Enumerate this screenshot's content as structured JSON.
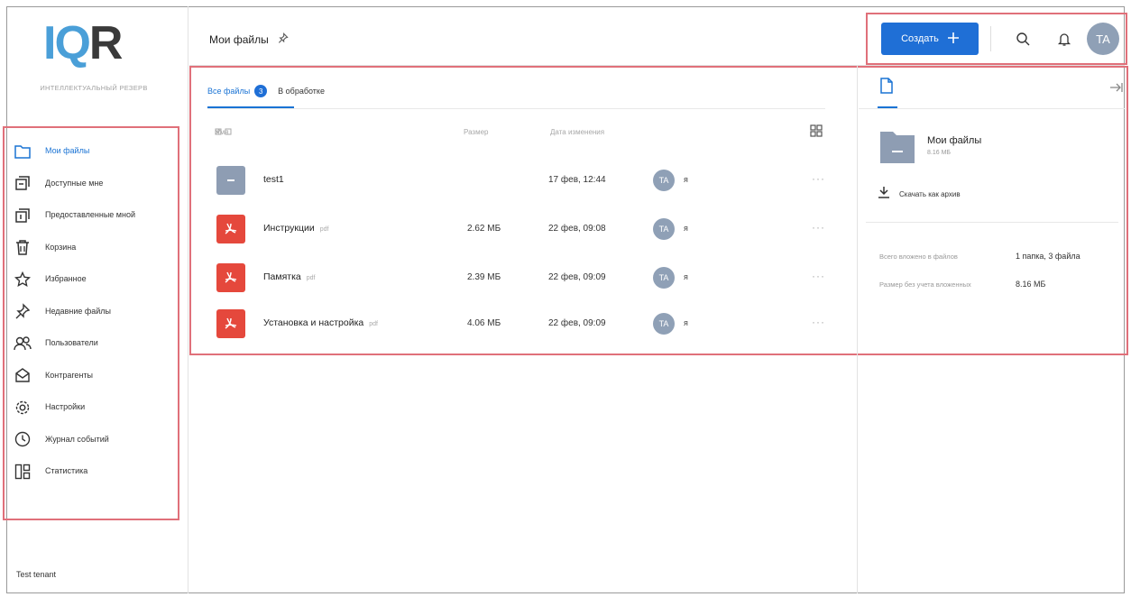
{
  "brand": {
    "logo_part1": "IQ",
    "logo_part2": "R",
    "subtitle": "ИНТЕЛЛЕКТУАЛЬНЫЙ РЕЗЕРВ"
  },
  "sidebar": {
    "items": [
      {
        "label": "Мои файлы",
        "icon": "folder-icon"
      },
      {
        "label": "Доступные мне",
        "icon": "shared-inbox-icon"
      },
      {
        "label": "Предоставленные мной",
        "icon": "shared-outbox-icon"
      },
      {
        "label": "Корзина",
        "icon": "trash-icon"
      },
      {
        "label": "Избранное",
        "icon": "star-icon"
      },
      {
        "label": "Недавние файлы",
        "icon": "pin-icon"
      },
      {
        "label": "Пользователи",
        "icon": "users-icon"
      },
      {
        "label": "Контрагенты",
        "icon": "contractors-icon"
      },
      {
        "label": "Настройки",
        "icon": "gear-icon"
      },
      {
        "label": "Журнал событий",
        "icon": "clock-icon"
      },
      {
        "label": "Статистика",
        "icon": "stats-icon"
      }
    ],
    "tenant": "Test tenant"
  },
  "header": {
    "title": "Мои файлы",
    "create_label": "Создать",
    "avatar_initials": "TA"
  },
  "tabs": [
    {
      "label": "Все файлы",
      "count": "3"
    },
    {
      "label": "В обработке"
    }
  ],
  "table": {
    "columns": {
      "name": "Имя",
      "size": "Размер",
      "date": "Дата изменения"
    },
    "rows": [
      {
        "name": "test1",
        "ext": "",
        "size": "",
        "date": "17 фев, 12:44",
        "avatar": "TA",
        "owner": "я",
        "type": "folder"
      },
      {
        "name": "Инструкции",
        "ext": "pdf",
        "size": "2.62 МБ",
        "date": "22 фев, 09:08",
        "avatar": "TA",
        "owner": "я",
        "type": "pdf"
      },
      {
        "name": "Памятка",
        "ext": "pdf",
        "size": "2.39 МБ",
        "date": "22 фев, 09:09",
        "avatar": "TA",
        "owner": "я",
        "type": "pdf"
      },
      {
        "name": "Установка и настройка",
        "ext": "pdf",
        "size": "4.06 МБ",
        "date": "22 фев, 09:09",
        "avatar": "TA",
        "owner": "я",
        "type": "pdf"
      }
    ],
    "more": "···"
  },
  "details": {
    "name": "Мои файлы",
    "size": "8.16 МБ",
    "download_label": "Скачать как архив",
    "props": [
      {
        "label": "Всего вложено в файлов",
        "value": "1 папка, 3 файла"
      },
      {
        "label": "Размер без учета вложенных",
        "value": "8.16 МБ"
      }
    ]
  },
  "colors": {
    "accent": "#1f6fd6",
    "pdf": "#e5483c",
    "folder": "#8e9db3",
    "highlight": "#e0707a"
  }
}
